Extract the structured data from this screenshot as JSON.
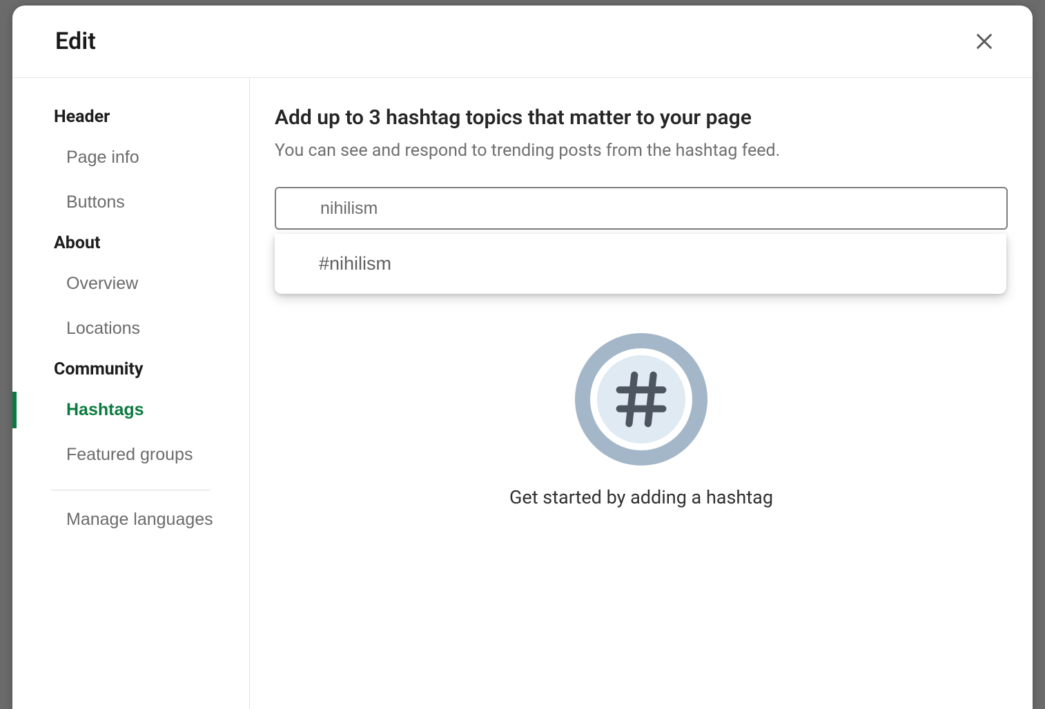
{
  "modal": {
    "title": "Edit"
  },
  "sidebar": {
    "sections": [
      {
        "header": "Header",
        "items": [
          {
            "label": "Page info",
            "active": false
          },
          {
            "label": "Buttons",
            "active": false
          }
        ]
      },
      {
        "header": "About",
        "items": [
          {
            "label": "Overview",
            "active": false
          },
          {
            "label": "Locations",
            "active": false
          }
        ]
      },
      {
        "header": "Community",
        "items": [
          {
            "label": "Hashtags",
            "active": true
          },
          {
            "label": "Featured groups",
            "active": false
          }
        ]
      }
    ],
    "footer_item": {
      "label": "Manage languages"
    }
  },
  "content": {
    "title": "Add up to 3 hashtag topics that matter to your page",
    "subtitle": "You can see and respond to trending posts from the hashtag feed.",
    "input_value": "nihilism",
    "suggestions": [
      {
        "label": "#nihilism"
      }
    ],
    "empty_state_text": "Get started by adding a hashtag"
  }
}
